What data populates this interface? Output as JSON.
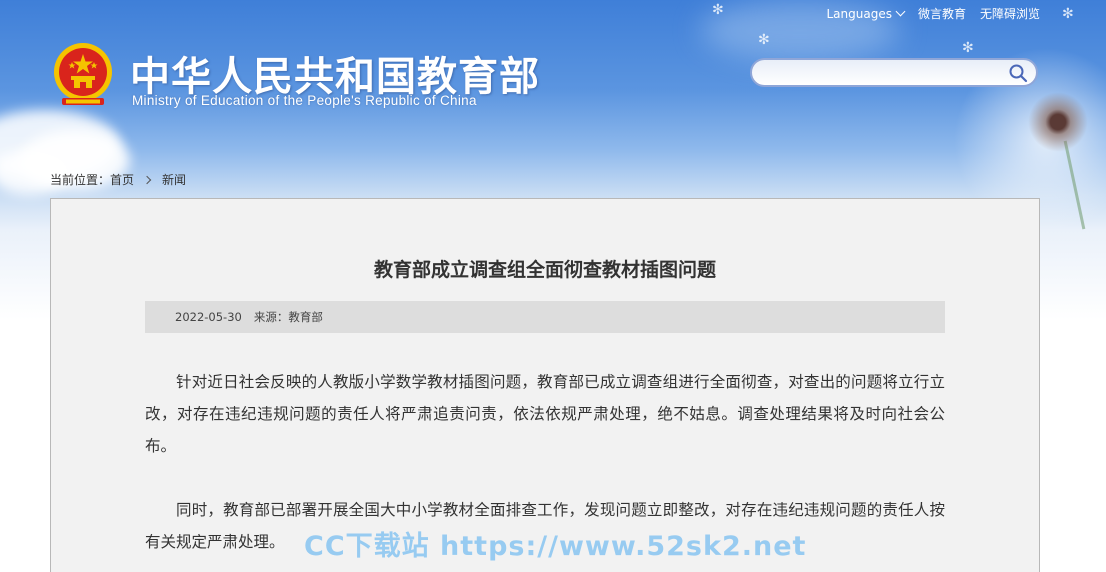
{
  "header": {
    "site_title_cn": "中华人民共和国教育部",
    "site_title_en": "Ministry of Education of the People's Republic of China",
    "links": {
      "languages": "Languages",
      "weiyan": "微言教育",
      "accessible": "无障碍浏览"
    },
    "search": {
      "value": "",
      "placeholder": ""
    }
  },
  "breadcrumb": {
    "label": "当前位置：",
    "home": "首页",
    "current": "新闻"
  },
  "article": {
    "title": "教育部成立调查组全面彻查教材插图问题",
    "date": "2022-05-30",
    "source": "来源：教育部",
    "paragraphs": [
      "针对近日社会反映的人教版小学数学教材插图问题，教育部已成立调查组进行全面彻查，对查出的问题将立行立改，对存在违纪违规问题的责任人将严肃追责问责，依法依规严肃处理，绝不姑息。调查处理结果将及时向社会公布。",
      "同时，教育部已部署开展全国大中小学教材全面排查工作，发现问题立即整改，对存在违纪违规问题的责任人按有关规定严肃处理。"
    ]
  },
  "watermark": "CC下载站 https://www.52sk2.net",
  "colors": {
    "header_blue": "#3f7fd8",
    "content_bg": "#f2f2f2",
    "meta_bg": "#dddddd",
    "text": "#333333",
    "emblem_red": "#d9241c",
    "emblem_gold": "#f5c400"
  },
  "icons": {
    "emblem": "national-emblem-icon",
    "search": "search-icon",
    "chevron": "chevron-down-icon",
    "breadcrumb_sep": "chevron-right-icon"
  }
}
